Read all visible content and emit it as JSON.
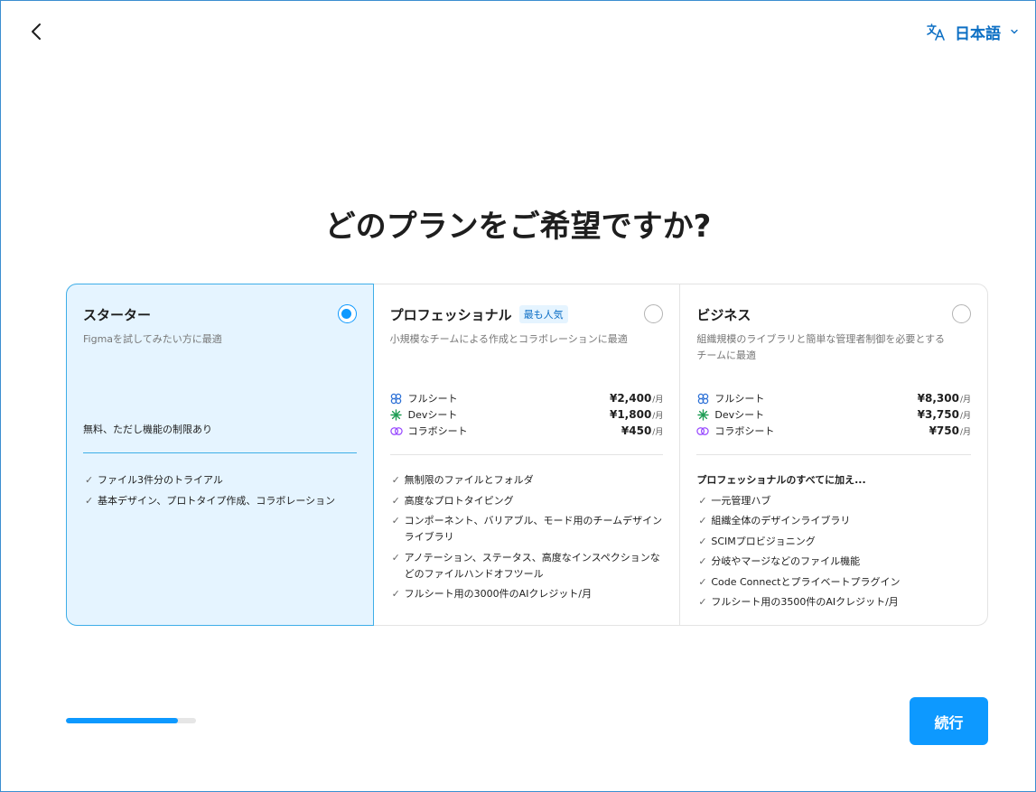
{
  "header": {
    "back_icon": "chevron-left-icon",
    "language": {
      "icon": "translate-icon",
      "label": "日本語",
      "caret_icon": "chevron-down-icon"
    }
  },
  "title": "どのプランをご希望ですか?",
  "plans": [
    {
      "name": "スターター",
      "description": "Figmaを試してみたい方に最適",
      "selected": true,
      "free_note": "無料、ただし機能の制限あり",
      "features": [
        "ファイル3件分のトライアル",
        "基本デザイン、プロトタイプ作成、コラボレーション"
      ]
    },
    {
      "name": "プロフェッショナル",
      "badge": "最も人気",
      "description": "小規模なチームによる作成とコラボレーションに最適",
      "selected": false,
      "seats": [
        {
          "icon": "full-seat-icon",
          "name": "フルシート",
          "price": "¥2,400",
          "unit": "/月"
        },
        {
          "icon": "dev-seat-icon",
          "name": "Devシート",
          "price": "¥1,800",
          "unit": "/月"
        },
        {
          "icon": "collab-seat-icon",
          "name": "コラボシート",
          "price": "¥450",
          "unit": "/月"
        }
      ],
      "features": [
        "無制限のファイルとフォルダ",
        "高度なプロトタイピング",
        "コンポーネント、バリアブル、モード用のチームデザインライブラリ",
        "アノテーション、ステータス、高度なインスペクションなどのファイルハンドオフツール",
        "フルシート用の3000件のAIクレジット/月"
      ]
    },
    {
      "name": "ビジネス",
      "description": "組織規模のライブラリと簡単な管理者制御を必要とするチームに最適",
      "selected": false,
      "seats": [
        {
          "icon": "full-seat-icon",
          "name": "フルシート",
          "price": "¥8,300",
          "unit": "/月"
        },
        {
          "icon": "dev-seat-icon",
          "name": "Devシート",
          "price": "¥3,750",
          "unit": "/月"
        },
        {
          "icon": "collab-seat-icon",
          "name": "コラボシート",
          "price": "¥750",
          "unit": "/月"
        }
      ],
      "features_heading": "プロフェッショナルのすべてに加え...",
      "features": [
        "一元管理ハブ",
        "組織全体のデザインライブラリ",
        "SCIMプロビジョニング",
        "分岐やマージなどのファイル機能",
        "Code Connectとプライベートプラグイン",
        "フルシート用の3500件のAIクレジット/月"
      ]
    }
  ],
  "progress": {
    "fraction": 0.86
  },
  "continue_label": "続行",
  "colors": {
    "accent": "#0d99ff",
    "selected_bg": "#e5f4ff",
    "selected_border": "#3eaee8",
    "link": "#0c6fc4"
  }
}
